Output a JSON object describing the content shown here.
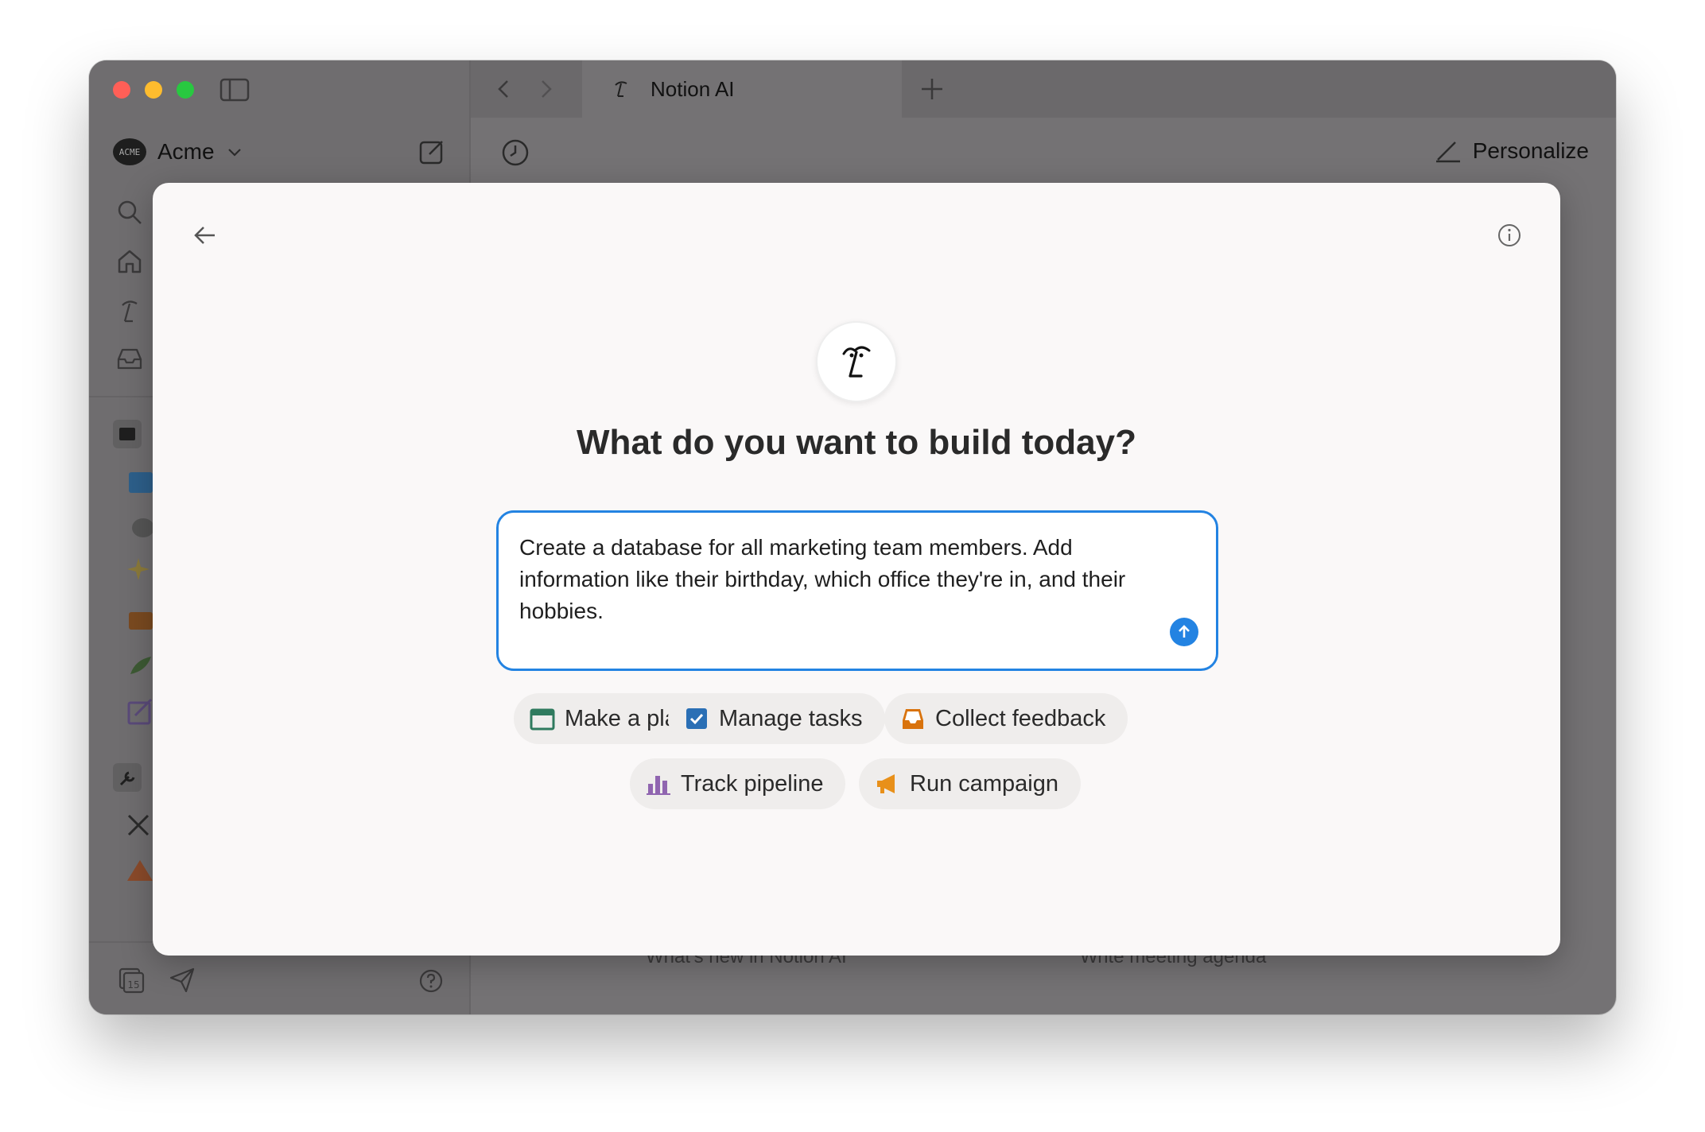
{
  "tab": {
    "title": "Notion AI"
  },
  "workspace": {
    "name": "Acme",
    "logo_text": "ACME"
  },
  "header": {
    "personalize_label": "Personalize"
  },
  "modal": {
    "heading": "What do you want to build today?",
    "prompt_value": "Create a database for all marketing team members. Add information like their birthday, which office they're in, and their hobbies.",
    "suggestions": [
      {
        "label": "Make a plan",
        "icon": "calendar-icon",
        "color": "#2f7a5e"
      },
      {
        "label": "Manage tasks",
        "icon": "checkbox-icon",
        "color": "#2a6fb5"
      },
      {
        "label": "Collect feedback",
        "icon": "inbox-tray-icon",
        "color": "#d9730d"
      },
      {
        "label": "Track pipeline",
        "icon": "bar-chart-icon",
        "color": "#9065b0"
      },
      {
        "label": "Run campaign",
        "icon": "megaphone-icon",
        "color": "#e8901a"
      }
    ]
  },
  "background_cards": [
    "What's new in Notion AI",
    "Write meeting agenda"
  ],
  "calendar_day": "15",
  "colors": {
    "accent": "#2383e2"
  }
}
